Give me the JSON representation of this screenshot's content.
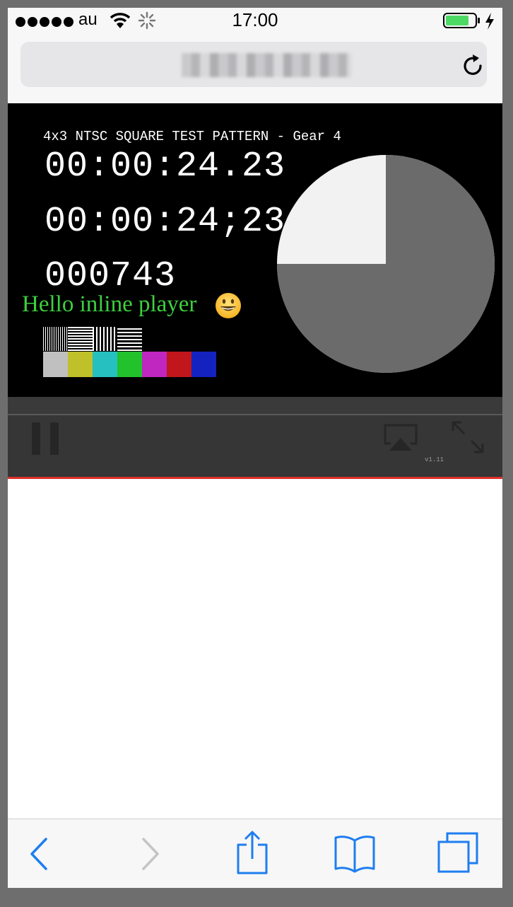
{
  "status_bar": {
    "carrier": "au",
    "time": "17:00",
    "signal_dots": 5,
    "battery_color": "#4cd964",
    "icons": [
      "wifi-icon",
      "loading-spinner-icon",
      "battery-icon",
      "charging-bolt-icon"
    ]
  },
  "address_bar": {
    "url": "",
    "reload_icon": "reload-icon"
  },
  "video": {
    "pattern_title": "4x3 NTSC SQUARE TEST PATTERN - Gear 4",
    "timecode_dot": "00:00:24.23",
    "timecode_semicolon": "00:00:24;23",
    "frame_count": "000743",
    "overlay_text": "Hello inline player",
    "overlay_color": "#3ecf3e",
    "smiley_icon": "grinning-face-icon",
    "color_bars": [
      "#c0c0c0",
      "#c0c02a",
      "#26c0c0",
      "#22c22c",
      "#c026c0",
      "#c0161c",
      "#1422c0"
    ],
    "pie": {
      "elapsed_fraction": 0.75,
      "elapsed_color": "#6b6b6b",
      "remaining_color": "#f2f2f2"
    }
  },
  "controls": {
    "version": "v1.11",
    "accent_color": "#e0302c",
    "icons": [
      "pause-icon",
      "airplay-icon",
      "fullscreen-icon"
    ]
  },
  "toolbar": {
    "accent_color": "#1e7ef0",
    "icons": [
      "back-icon",
      "forward-icon",
      "share-icon",
      "bookmarks-icon",
      "tabs-icon"
    ]
  }
}
